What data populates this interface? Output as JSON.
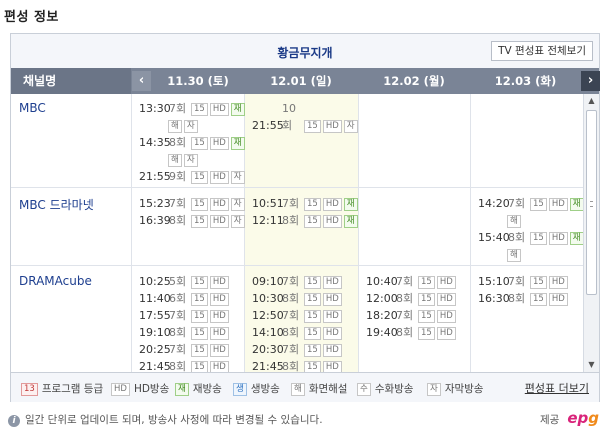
{
  "section_title": "편성 정보",
  "program_title": "황금무지개",
  "tv_schedule_button": "TV 편성표 전체보기",
  "channel_header": "채널명",
  "dates": [
    "11.30 (토)",
    "12.01 (일)",
    "12.02 (월)",
    "12.03 (화)"
  ],
  "channels": [
    {
      "name": "MBC",
      "days": [
        [
          {
            "time": "13:30",
            "ep": "7회",
            "badges": [
              "15",
              "HD",
              "재",
              "해",
              "자"
            ]
          },
          {
            "time": "14:35",
            "ep": "8회",
            "badges": [
              "15",
              "HD",
              "재",
              "해",
              "자"
            ]
          },
          {
            "time": "21:55",
            "ep": "9회",
            "badges": [
              "15",
              "HD",
              "자"
            ]
          }
        ],
        [
          {
            "time": "21:55",
            "ep": "10회",
            "badges": [
              "15",
              "HD",
              "자"
            ]
          }
        ],
        [],
        []
      ]
    },
    {
      "name": "MBC 드라마넷",
      "days": [
        [
          {
            "time": "15:23",
            "ep": "7회",
            "badges": [
              "15",
              "HD",
              "자"
            ]
          },
          {
            "time": "16:39",
            "ep": "8회",
            "badges": [
              "15",
              "HD",
              "자"
            ]
          }
        ],
        [
          {
            "time": "10:51",
            "ep": "7회",
            "badges": [
              "15",
              "HD",
              "재"
            ]
          },
          {
            "time": "12:11",
            "ep": "8회",
            "badges": [
              "15",
              "HD",
              "재"
            ]
          }
        ],
        [],
        [
          {
            "time": "14:20",
            "ep": "7회",
            "badges": [
              "15",
              "HD",
              "재",
              "해"
            ]
          },
          {
            "time": "15:40",
            "ep": "8회",
            "badges": [
              "15",
              "HD",
              "재",
              "해"
            ]
          }
        ]
      ]
    },
    {
      "name": "DRAMAcube",
      "days": [
        [
          {
            "time": "10:25",
            "ep": "5회",
            "badges": [
              "15",
              "HD"
            ]
          },
          {
            "time": "11:40",
            "ep": "6회",
            "badges": [
              "15",
              "HD"
            ]
          },
          {
            "time": "17:55",
            "ep": "7회",
            "badges": [
              "15",
              "HD"
            ]
          },
          {
            "time": "19:10",
            "ep": "8회",
            "badges": [
              "15",
              "HD"
            ]
          },
          {
            "time": "20:25",
            "ep": "7회",
            "badges": [
              "15",
              "HD"
            ]
          },
          {
            "time": "21:45",
            "ep": "8회",
            "badges": [
              "15",
              "HD"
            ]
          }
        ],
        [
          {
            "time": "09:10",
            "ep": "7회",
            "badges": [
              "15",
              "HD"
            ]
          },
          {
            "time": "10:30",
            "ep": "8회",
            "badges": [
              "15",
              "HD"
            ]
          },
          {
            "time": "12:50",
            "ep": "7회",
            "badges": [
              "15",
              "HD"
            ]
          },
          {
            "time": "14:10",
            "ep": "8회",
            "badges": [
              "15",
              "HD"
            ]
          },
          {
            "time": "20:30",
            "ep": "7회",
            "badges": [
              "15",
              "HD"
            ]
          },
          {
            "time": "21:45",
            "ep": "8회",
            "badges": [
              "15",
              "HD"
            ]
          }
        ],
        [
          {
            "time": "10:40",
            "ep": "7회",
            "badges": [
              "15",
              "HD"
            ]
          },
          {
            "time": "12:00",
            "ep": "8회",
            "badges": [
              "15",
              "HD"
            ]
          },
          {
            "time": "18:20",
            "ep": "7회",
            "badges": [
              "15",
              "HD"
            ]
          },
          {
            "time": "19:40",
            "ep": "8회",
            "badges": [
              "15",
              "HD"
            ]
          }
        ],
        [
          {
            "time": "15:10",
            "ep": "7회",
            "badges": [
              "15",
              "HD"
            ]
          },
          {
            "time": "16:30",
            "ep": "8회",
            "badges": [
              "15",
              "HD"
            ]
          }
        ]
      ]
    }
  ],
  "legend": [
    {
      "badge": "13",
      "label": "프로그램 등급",
      "style": "red"
    },
    {
      "badge": "HD",
      "label": "HD방송",
      "style": "plain"
    },
    {
      "badge": "재",
      "label": "재방송",
      "style": "green"
    },
    {
      "badge": "생",
      "label": "생방송",
      "style": "blue"
    },
    {
      "badge": "해",
      "label": "화면해설",
      "style": "plain"
    },
    {
      "badge": "수",
      "label": "수화방송",
      "style": "plain"
    },
    {
      "badge": "자",
      "label": "자막방송",
      "style": "plain"
    }
  ],
  "more_link": "편성표 더보기",
  "footer_note": "일간 단위로 업데이트 되며, 방송사 사정에 따라 변경될 수 있습니다.",
  "provider_label": "제공",
  "provider_logo": {
    "e": "e",
    "p": "p",
    "g": "g"
  },
  "colors": {
    "date_bar": "#7a8496",
    "title": "#1b3a87",
    "today_bg": "#fbfbe9",
    "epg_pink": "#d9237a",
    "epg_orange": "#f08a1c"
  }
}
